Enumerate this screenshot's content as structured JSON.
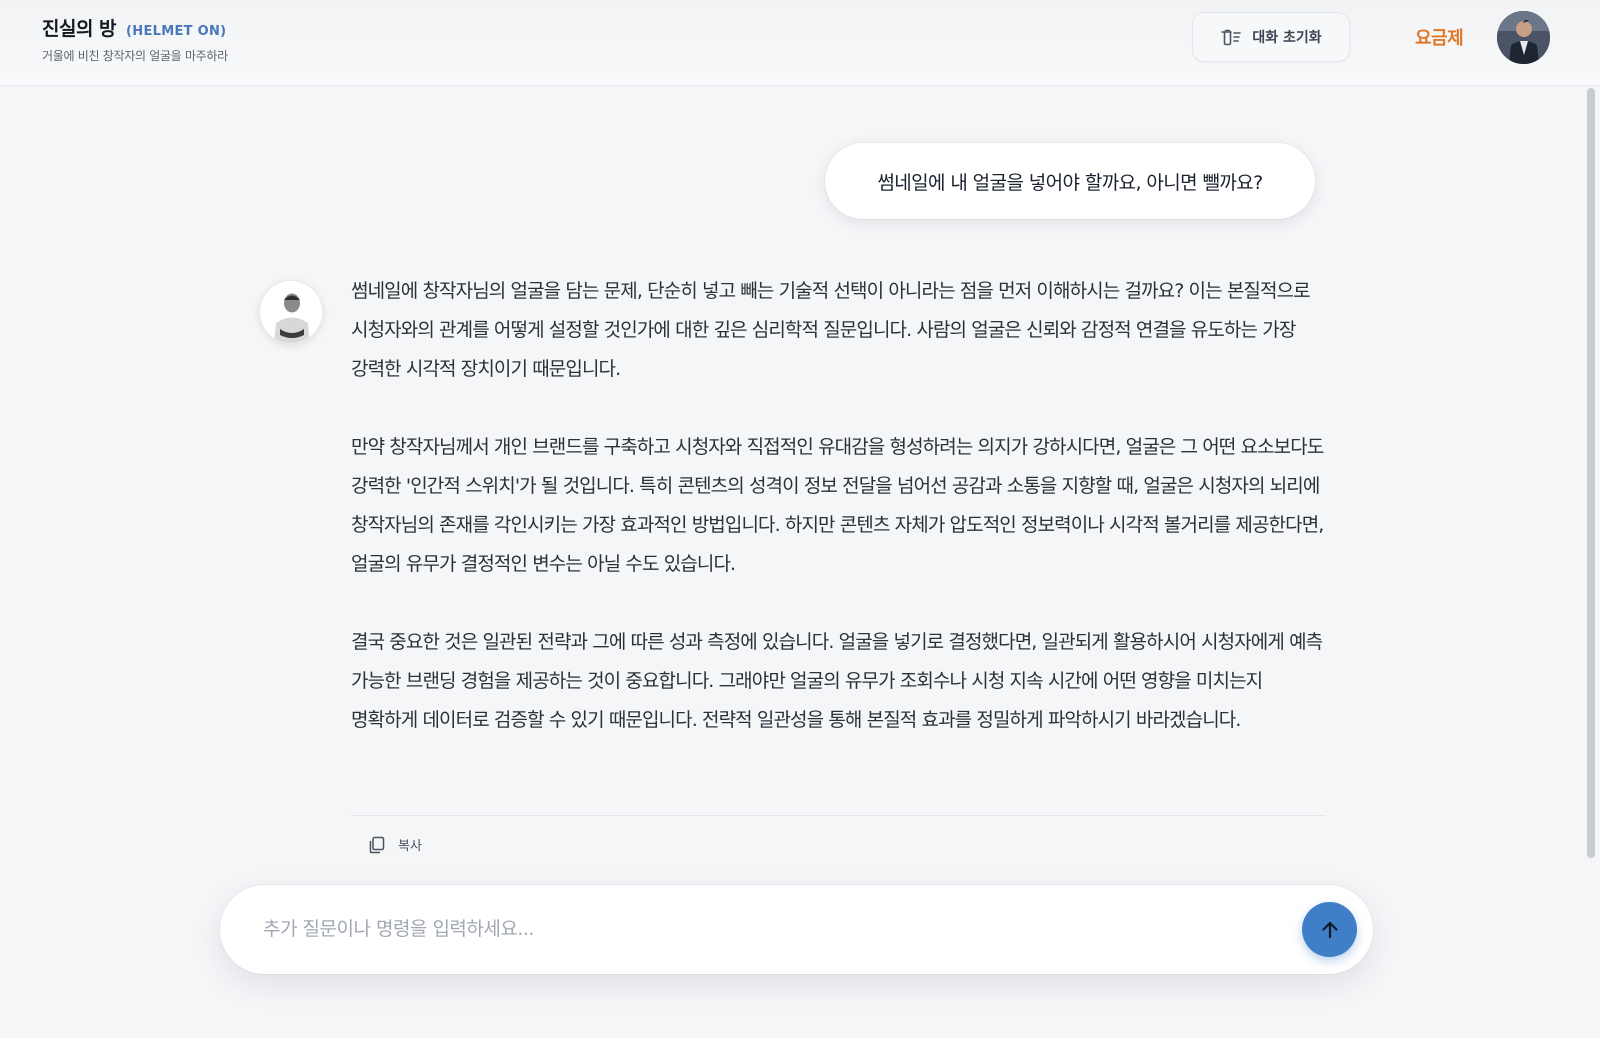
{
  "header": {
    "title": "진실의 방",
    "tag": "(HELMET ON)",
    "subtitle": "거울에 비친 창작자의 얼굴을 마주하라",
    "reset_label": "대화 초기화",
    "pricing_label": "요금제"
  },
  "chat": {
    "user_message": "썸네일에 내 얼굴을 넣어야 할까요, 아니면 뺄까요?",
    "ai_paragraphs": [
      "썸네일에 창작자님의 얼굴을 담는 문제, 단순히 넣고 빼는 기술적 선택이 아니라는 점을 먼저 이해하시는 걸까요? 이는 본질적으로 시청자와의 관계를 어떻게 설정할 것인가에 대한 깊은 심리학적 질문입니다. 사람의 얼굴은 신뢰와 감정적 연결을 유도하는 가장 강력한 시각적 장치이기 때문입니다.",
      "만약 창작자님께서 개인 브랜드를 구축하고 시청자와 직접적인 유대감을 형성하려는 의지가 강하시다면, 얼굴은 그 어떤 요소보다도 강력한 '인간적 스위치'가 될 것입니다. 특히 콘텐츠의 성격이 정보 전달을 넘어선 공감과 소통을 지향할 때, 얼굴은 시청자의 뇌리에 창작자님의 존재를 각인시키는 가장 효과적인 방법입니다. 하지만 콘텐츠 자체가 압도적인 정보력이나 시각적 볼거리를 제공한다면, 얼굴의 유무가 결정적인 변수는 아닐 수도 있습니다.",
      "결국 중요한 것은 일관된 전략과 그에 따른 성과 측정에 있습니다. 얼굴을 넣기로 결정했다면, 일관되게 활용하시어 시청자에게 예측 가능한 브랜딩 경험을 제공하는 것이 중요합니다. 그래야만 얼굴의 유무가 조회수나 시청 지속 시간에 어떤 영향을 미치는지 명확하게 데이터로 검증할 수 있기 때문입니다. 전략적 일관성을 통해 본질적 효과를 정밀하게 파악하시기 바라겠습니다."
    ],
    "copy_label": "복사"
  },
  "input": {
    "placeholder": "추가 질문이나 명령을 입력하세요...",
    "value": ""
  },
  "icons": {
    "reset": "trash-list-icon",
    "copy": "copy-icon",
    "send": "arrow-up-icon"
  },
  "colors": {
    "accent": "#3f7fc8",
    "tag": "#4a78b8",
    "pricing": "#e0782a",
    "background": "#f5f6f8"
  }
}
